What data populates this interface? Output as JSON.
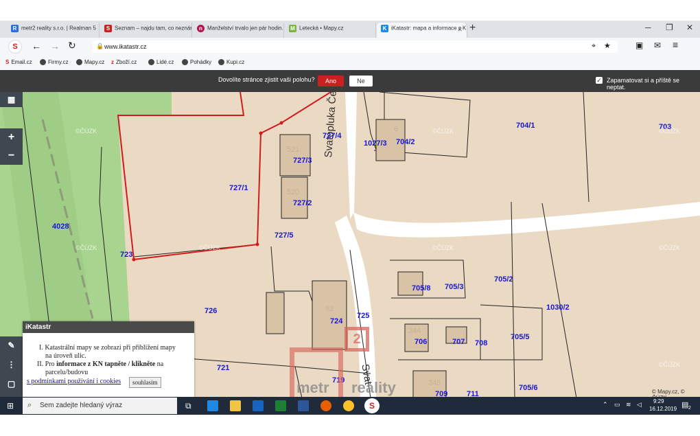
{
  "browser": {
    "tabs": [
      {
        "title": "metr2 reality s.r.o. | Realman 5",
        "active": false,
        "fav_color": "#2a6fdb",
        "fav_glyph": "R"
      },
      {
        "title": "Seznam – najdu tam, co neznám",
        "active": false,
        "fav_color": "#cc1f1f",
        "fav_glyph": "S"
      },
      {
        "title": "Manželství trvalo jen pár hodin. S",
        "active": false,
        "fav_color": "#b3134b",
        "fav_glyph": "n"
      },
      {
        "title": "Letecká • Mapy.cz",
        "active": false,
        "fav_color": "#7cb342",
        "fav_glyph": "M"
      },
      {
        "title": "iKatastr: mapa a informace z KN",
        "active": true,
        "fav_color": "#1e88e5",
        "fav_glyph": "K"
      }
    ],
    "url": "www.ikatastr.cz",
    "bookmarks": [
      "Email.cz",
      "Firmy.cz",
      "Mapy.cz",
      "Zboží.cz",
      "Lidé.cz",
      "Pohádky",
      "Kupi.cz"
    ]
  },
  "permission_bar": {
    "question": "Dovolíte stránce zjistit vaši polohu?",
    "yes_label": "Ano",
    "no_label": "Ne",
    "remember_label": "Zapamatovat si a příště se neptat."
  },
  "map": {
    "street_name": "Svatoplukа Čecha",
    "street_name_lower": "Svat",
    "parcel_labels": [
      {
        "id": "p4028",
        "text": "4028"
      },
      {
        "id": "p723",
        "text": "723"
      },
      {
        "id": "p727_1",
        "text": "727/1"
      },
      {
        "id": "p727_3",
        "text": "727/3"
      },
      {
        "id": "p727_2",
        "text": "727/2"
      },
      {
        "id": "p727_4",
        "text": "727/4"
      },
      {
        "id": "p727_5",
        "text": "727/5"
      },
      {
        "id": "p1027_3",
        "text": "1027/3"
      },
      {
        "id": "p704_2",
        "text": "704/2"
      },
      {
        "id": "p704_1",
        "text": "704/1"
      },
      {
        "id": "p703",
        "text": "703"
      },
      {
        "id": "p705_8",
        "text": "705/8"
      },
      {
        "id": "p705_3",
        "text": "705/3"
      },
      {
        "id": "p705_2",
        "text": "705/2"
      },
      {
        "id": "p1030_2",
        "text": "1030/2"
      },
      {
        "id": "p726",
        "text": "726"
      },
      {
        "id": "p724",
        "text": "724"
      },
      {
        "id": "p725",
        "text": "725"
      },
      {
        "id": "p706",
        "text": "706"
      },
      {
        "id": "p707",
        "text": "707"
      },
      {
        "id": "p708",
        "text": "708"
      },
      {
        "id": "p705_5",
        "text": "705/5"
      },
      {
        "id": "p721",
        "text": "721"
      },
      {
        "id": "p719",
        "text": "719"
      },
      {
        "id": "p709",
        "text": "709"
      },
      {
        "id": "p711",
        "text": "711"
      },
      {
        "id": "p705_6",
        "text": "705/6"
      }
    ],
    "building_numbers": [
      "521",
      "520",
      "6",
      "92",
      "344",
      "345"
    ],
    "watermark": "©ČÚZK",
    "attribution": "© Mapy.cz, © ČÚZK",
    "logo_text": "metr",
    "logo_text2": "reality",
    "logo_number": "2",
    "colors": {
      "boundary": "#d21b1b",
      "parcel_label": "#1a16d6",
      "road": "#ffffff",
      "green": "#a8d48f",
      "land": "#ead9c3"
    }
  },
  "info_panel": {
    "title": "iKatastr",
    "line1": "I. Katastrální mapy se zobrazí při přiblížení mapy",
    "line1b": "na úroveň ulic.",
    "line2a": "II. Pro ",
    "line2b": "informace z KN tapněte / klikněte",
    "line2c": " na",
    "line2d": "parcelu/budovu",
    "terms_link": "s podmínkami používání i cookies",
    "accept": "souhlasím"
  },
  "taskbar": {
    "search_placeholder": "Sem zadejte hledaný výraz",
    "time": "9:29",
    "date": "16.12.2019",
    "notification_count": "2"
  }
}
